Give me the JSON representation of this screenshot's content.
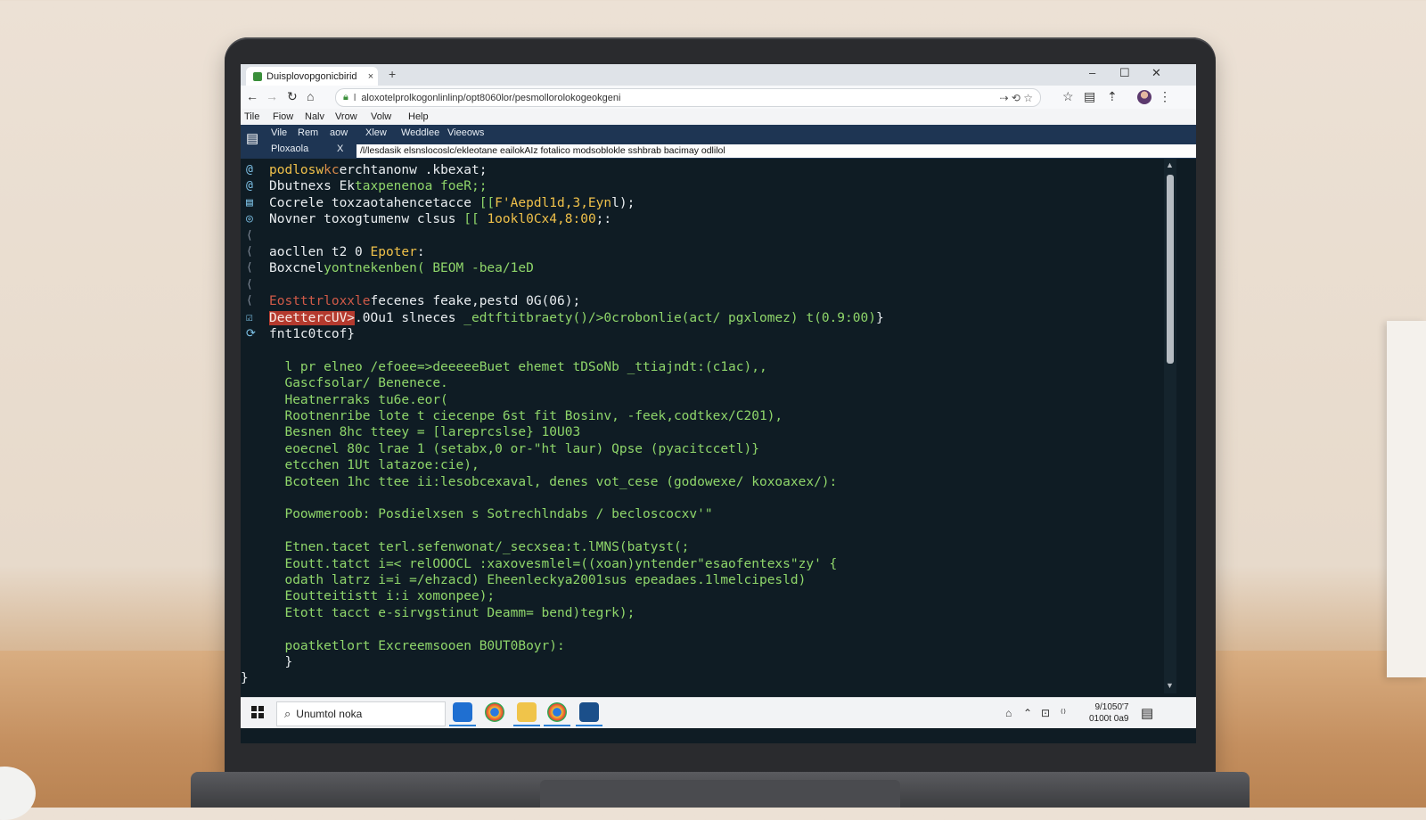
{
  "browser": {
    "tab_title": "Duisplovopgonicbirid",
    "tab_close": "×",
    "new_tab": "+",
    "window_controls": [
      "–",
      "☐",
      "✕"
    ],
    "url": "aloxotelprolkogonlinlinp/opt8060lor/pesmollorolokogeokgeni",
    "url_prefix": "l",
    "nav": [
      "←",
      "→",
      "↻",
      "⌂"
    ],
    "omnibox_icons": "⇢ ⟲  ☆",
    "toolbar_icons": [
      "☆",
      "▤",
      "⇡",
      "⋮"
    ]
  },
  "menubar": {
    "items": [
      "Tile",
      "Fiow",
      "Nalv",
      "Vrow",
      "Volw",
      "Help"
    ]
  },
  "editor_toolbar": {
    "items": [
      "Vile",
      "Rem",
      "aow",
      "Xlew",
      "Weddlee",
      "Vieeows"
    ]
  },
  "editor_tab": {
    "label": "Ploxaola",
    "close": "X",
    "path": "/l/lesdasik elsnslocoslc/ekleotane eailokAIz fotalico modsoblokle sshbrab bacimay odlilol"
  },
  "code": {
    "lines": [
      {
        "gutter": "@",
        "parts": [
          {
            "t": "podlosw",
            "c": "y"
          },
          {
            "t": "kc",
            "c": "o"
          },
          {
            "t": "erchtanonw .kbexat;",
            "c": "w"
          }
        ]
      },
      {
        "gutter": "@",
        "parts": [
          {
            "t": "Dbutnexs Ek",
            "c": "w"
          },
          {
            "t": "taxpenenoa foeR;;",
            "c": "g"
          }
        ]
      },
      {
        "gutter": "▤",
        "parts": [
          {
            "t": "Cocrele toxzaotahencetacce ",
            "c": "w"
          },
          {
            "t": "[[",
            "c": "g"
          },
          {
            "t": "F'Aepdl1d,3,Eyn",
            "c": "y"
          },
          {
            "t": "l);",
            "c": "w"
          }
        ]
      },
      {
        "gutter": "◎",
        "parts": [
          {
            "t": "Novner toxogtumenw clsus ",
            "c": "w"
          },
          {
            "t": "[[ ",
            "c": "g"
          },
          {
            "t": "1ookl0Cx4,8:00",
            "c": "y"
          },
          {
            "t": ";:",
            "c": "w"
          }
        ]
      },
      {
        "gutter": "⟨",
        "parts": []
      },
      {
        "gutter": "⟨",
        "parts": [
          {
            "t": "aocllen t2 0 ",
            "c": "w"
          },
          {
            "t": "Epoter",
            "c": "y"
          },
          {
            "t": ":",
            "c": "w"
          }
        ]
      },
      {
        "gutter": "⟨",
        "parts": [
          {
            "t": "Boxcnel",
            "c": "w"
          },
          {
            "t": "yontnekenben( ",
            "c": "g"
          },
          {
            "t": "BEOM -bea/1eD",
            "c": "g"
          }
        ]
      },
      {
        "gutter": "⟨",
        "parts": []
      },
      {
        "gutter": "⟨",
        "parts": [
          {
            "t": "Eostttrloxxle",
            "c": "red"
          },
          {
            "t": "fecenes feake,pestd 0G(06);",
            "c": "w"
          }
        ]
      },
      {
        "gutter": "☑",
        "parts": [
          {
            "t": "DeettercUV>",
            "c": "hl"
          },
          {
            "t": ".0Ou1 slneces ",
            "c": "w"
          },
          {
            "t": "_edtftitbraety()/>0crobonlie(act/ pgxlomez) t(0.9:00)",
            "c": "g"
          },
          {
            "t": "}",
            "c": "w"
          }
        ]
      },
      {
        "gutter": "⟳",
        "parts": [
          {
            "t": "fnt1c0tcof}",
            "c": "w"
          }
        ]
      },
      {
        "gutter": "",
        "parts": []
      },
      {
        "gutter": "",
        "parts": [
          {
            "t": "  l pr elneo /efoee=>deeeeeBuet ehemet tDSoNb _ttiajndt:(c1ac),,",
            "c": "g"
          }
        ]
      },
      {
        "gutter": "",
        "parts": [
          {
            "t": "  Gascfsolar/ Benenece.",
            "c": "g"
          }
        ]
      },
      {
        "gutter": "",
        "parts": [
          {
            "t": "  Heatnerraks tu6e.eor(",
            "c": "g"
          }
        ]
      },
      {
        "gutter": "",
        "parts": [
          {
            "t": "  Rootnenribe lote t ciecenpe 6st fit Bosinv, -feek,codtkex/C201),",
            "c": "g"
          }
        ]
      },
      {
        "gutter": "",
        "parts": [
          {
            "t": "  Besnen 8hc tteey = [lareprcslse} 10U03",
            "c": "g"
          }
        ]
      },
      {
        "gutter": "",
        "parts": [
          {
            "t": "  eoecnel 80c lrae 1 (setabx,0 or-\"ht laur) Qpse (pyacitccetl)}",
            "c": "g"
          }
        ]
      },
      {
        "gutter": "",
        "parts": [
          {
            "t": "  etcchen 1Ut latazoe:cie),",
            "c": "g"
          }
        ]
      },
      {
        "gutter": "",
        "parts": [
          {
            "t": "  Bcoteen 1hc ttee ii:lesobcexaval, denes vot_cese (godowexe/ koxoaxex/):",
            "c": "g"
          }
        ]
      },
      {
        "gutter": "",
        "parts": []
      },
      {
        "gutter": "",
        "parts": [
          {
            "t": "  Poowmeroob: Posdielxsen s Sotrechlndabs / becloscocxv'\"",
            "c": "g"
          }
        ]
      },
      {
        "gutter": "",
        "parts": []
      },
      {
        "gutter": "",
        "parts": [
          {
            "t": "  Etnen.tacet terl.sefenwonat/_secxsea:t.lMNS(batyst(;",
            "c": "g"
          }
        ]
      },
      {
        "gutter": "",
        "parts": [
          {
            "t": "  Eoutt.tatct i=< relOOOCL :xaxovesmlel=((xoan)yntender\"esaofentexs\"zy' {",
            "c": "g"
          }
        ]
      },
      {
        "gutter": "",
        "parts": [
          {
            "t": "  odath latrz i=i =/ehzacd) Eheenleckya2001sus epeadaes.1lmelcipesld)",
            "c": "g"
          }
        ]
      },
      {
        "gutter": "",
        "parts": [
          {
            "t": "  Eoutteitistt i:i xomonpee);",
            "c": "g"
          }
        ]
      },
      {
        "gutter": "",
        "parts": [
          {
            "t": "  Etott tacct e-sirvgstinut Deamm= bend)tegrk);",
            "c": "g"
          }
        ]
      },
      {
        "gutter": "",
        "parts": []
      },
      {
        "gutter": "",
        "parts": [
          {
            "t": "  poatketlort Excreemsooen B0UT0Boyr):",
            "c": "g"
          }
        ]
      },
      {
        "gutter": "",
        "parts": [
          {
            "t": "  }",
            "c": "w"
          }
        ]
      },
      {
        "gutter": "",
        "parts": [
          {
            "t": "}",
            "c": "w"
          }
        ]
      }
    ]
  },
  "scrollbar": {
    "up": "▲",
    "down": "▼"
  },
  "taskbar": {
    "search_text": "Unumtol noka",
    "search_icon": "search-icon",
    "clock_line1": "9/1050'7",
    "clock_line2": "0100t 0a9",
    "tray": [
      "⌂",
      "⌃",
      "⊡",
      "⁽⁾"
    ],
    "notif": "▤"
  }
}
